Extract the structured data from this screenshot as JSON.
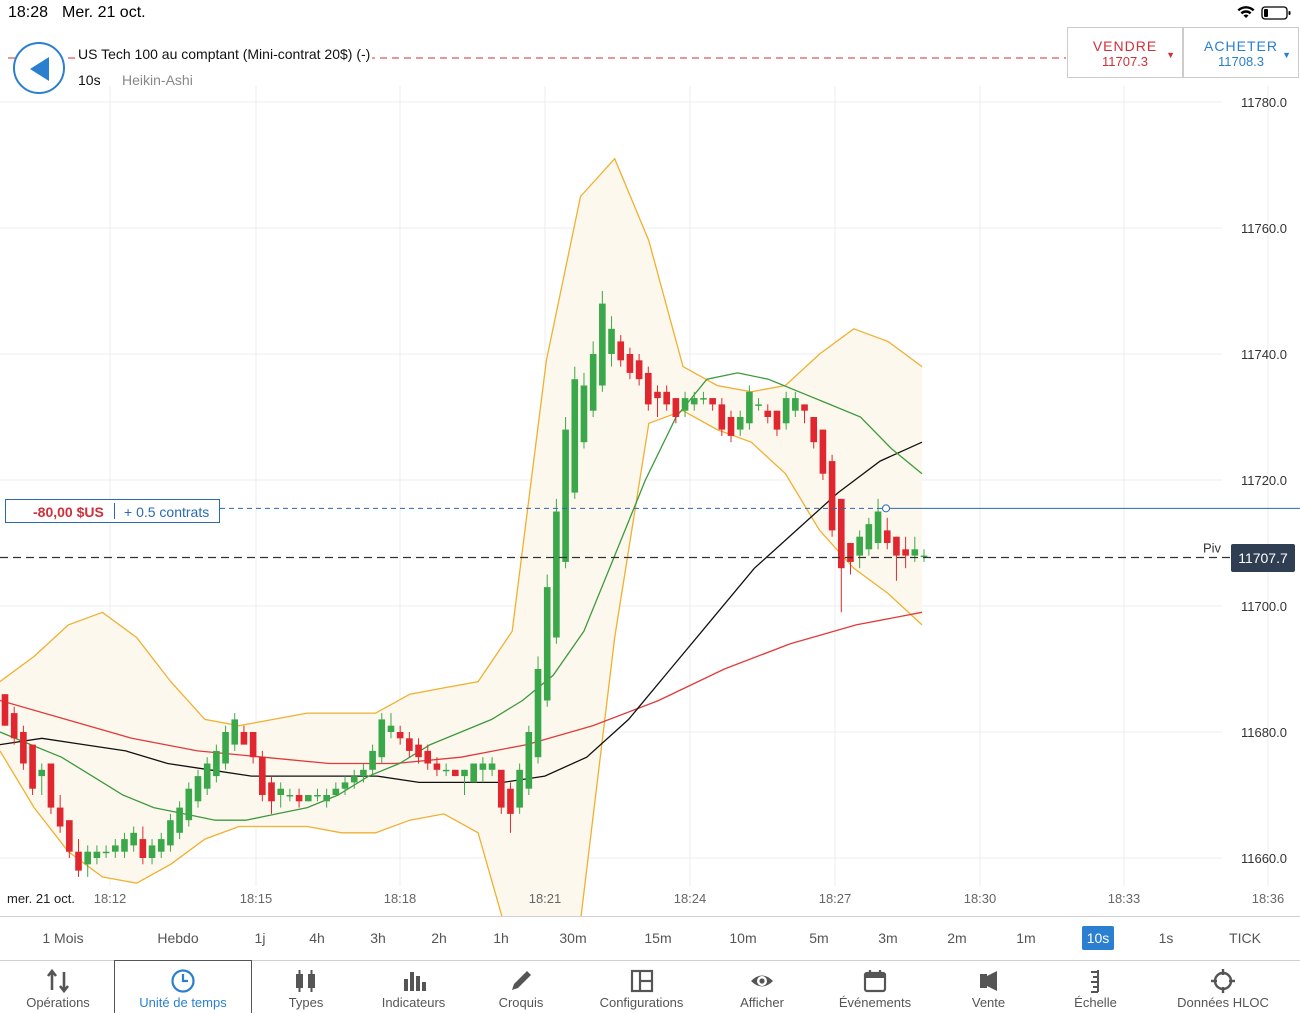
{
  "status_bar": {
    "time": "18:28",
    "date": "Mer. 21 oct."
  },
  "header": {
    "instrument": "US Tech 100 au comptant (Mini-contrat 20$) (-)",
    "timeframe": "10s",
    "chart_type": "Heikin-Ashi"
  },
  "trade": {
    "sell_label": "VENDRE",
    "sell_price": "11707.3",
    "buy_label": "ACHETER",
    "buy_price": "11708.3"
  },
  "position": {
    "pnl": "-80,00 $US",
    "size": "+ 0.5 contrats"
  },
  "pivot_label": "Piv",
  "current_price": "11707.7",
  "date_label": "mer. 21 oct.",
  "colors": {
    "up_candle": "#3aa84a",
    "down_candle": "#e0262f",
    "bollinger": "#f0b030",
    "bollinger_fill": "#fdf8ee",
    "ma_green": "#3c9a3c",
    "ma_black": "#111111",
    "ma_red": "#e03a3a",
    "accent": "#2a7fd1"
  },
  "timeframes": [
    "1 Mois",
    "Hebdo",
    "1j",
    "4h",
    "3h",
    "2h",
    "1h",
    "30m",
    "15m",
    "10m",
    "5m",
    "3m",
    "2m",
    "1m",
    "10s",
    "1s",
    "TICK"
  ],
  "active_timeframe": "10s",
  "toolbar": [
    {
      "label": "Opérations",
      "icon": "arrows-updown-icon"
    },
    {
      "label": "Unité de temps",
      "icon": "clock-icon"
    },
    {
      "label": "Types",
      "icon": "candles-icon"
    },
    {
      "label": "Indicateurs",
      "icon": "bar-chart-icon"
    },
    {
      "label": "Croquis",
      "icon": "pencil-icon"
    },
    {
      "label": "Configurations",
      "icon": "layout-icon"
    },
    {
      "label": "Afficher",
      "icon": "eye-icon"
    },
    {
      "label": "Événements",
      "icon": "calendar-icon"
    },
    {
      "label": "Vente",
      "icon": "speaker-icon"
    },
    {
      "label": "Échelle",
      "icon": "scale-icon"
    },
    {
      "label": "Données HLOC",
      "icon": "crosshair-icon"
    }
  ],
  "active_tool": "Unité de temps",
  "chart_data": {
    "type": "candlestick",
    "price_axis": {
      "ticks": [
        11660,
        11680,
        11700,
        11720,
        11740,
        11760,
        11780
      ],
      "tick_labels": [
        "11660.0",
        "11680.0",
        "11700.0",
        "11720.0",
        "11740.0",
        "11760.0",
        "11780.0"
      ]
    },
    "time_axis": {
      "labels": [
        "18:12",
        "18:15",
        "18:18",
        "18:21",
        "18:24",
        "18:27",
        "18:30",
        "18:33",
        "18:36"
      ]
    },
    "pivot": 11707.7,
    "position_entry": 11715.5,
    "candles": [
      [
        11686,
        11686,
        11681,
        11681
      ],
      [
        11683,
        11684,
        11678,
        11679
      ],
      [
        11680,
        11681,
        11674,
        11675
      ],
      [
        11678,
        11678,
        11670,
        11671
      ],
      [
        11673,
        11675,
        11670,
        11674
      ],
      [
        11675,
        11675,
        11667,
        11668
      ],
      [
        11668,
        11670,
        11664,
        11665
      ],
      [
        11666,
        11666,
        11660,
        11661
      ],
      [
        11661,
        11663,
        11657,
        11658
      ],
      [
        11659,
        11662,
        11657,
        11661
      ],
      [
        11660,
        11662,
        11659,
        11661
      ],
      [
        11661,
        11662,
        11660,
        11661
      ],
      [
        11661,
        11663,
        11660,
        11662
      ],
      [
        11661,
        11664,
        11660,
        11663
      ],
      [
        11662,
        11665,
        11661,
        11664
      ],
      [
        11663,
        11665,
        11659,
        11660
      ],
      [
        11660,
        11663,
        11659,
        11662
      ],
      [
        11661,
        11664,
        11660,
        11663
      ],
      [
        11662,
        11667,
        11661,
        11666
      ],
      [
        11664,
        11669,
        11663,
        11668
      ],
      [
        11666,
        11672,
        11665,
        11671
      ],
      [
        11669,
        11674,
        11668,
        11673
      ],
      [
        11671,
        11676,
        11670,
        11675
      ],
      [
        11673,
        11678,
        11672,
        11677
      ],
      [
        11675,
        11681,
        11674,
        11680
      ],
      [
        11678,
        11683,
        11677,
        11682
      ],
      [
        11680,
        11681,
        11678,
        11678
      ],
      [
        11680,
        11680,
        11675,
        11676
      ],
      [
        11676,
        11677,
        11669,
        11670
      ],
      [
        11672,
        11673,
        11667,
        11669
      ],
      [
        11670,
        11672,
        11668,
        11671
      ],
      [
        11670,
        11671,
        11669,
        11670
      ],
      [
        11670,
        11671,
        11668,
        11669
      ],
      [
        11669,
        11670,
        11669,
        11670
      ],
      [
        11670,
        11671,
        11669,
        11670
      ],
      [
        11669,
        11671,
        11668,
        11670
      ],
      [
        11670,
        11672,
        11670,
        11671
      ],
      [
        11671,
        11673,
        11670,
        11672
      ],
      [
        11672,
        11674,
        11671,
        11673
      ],
      [
        11673,
        11675,
        11672,
        11674
      ],
      [
        11674,
        11678,
        11673,
        11677
      ],
      [
        11676,
        11683,
        11675,
        11682
      ],
      [
        11680,
        11683,
        11679,
        11681
      ],
      [
        11680,
        11681,
        11678,
        11679
      ],
      [
        11679,
        11680,
        11676,
        11677
      ],
      [
        11678,
        11679,
        11675,
        11676
      ],
      [
        11677,
        11678,
        11674,
        11675
      ],
      [
        11675,
        11676,
        11673,
        11674
      ],
      [
        11674,
        11675,
        11673,
        11674
      ],
      [
        11674,
        11674,
        11673,
        11673
      ],
      [
        11673,
        11674,
        11670,
        11674
      ],
      [
        11672,
        11675,
        11672,
        11675
      ],
      [
        11674,
        11676,
        11672,
        11675
      ],
      [
        11674,
        11676,
        11673,
        11675
      ],
      [
        11674,
        11673,
        11667,
        11668
      ],
      [
        11671,
        11672,
        11664,
        11667
      ],
      [
        11668,
        11675,
        11667,
        11674
      ],
      [
        11671,
        11681,
        11670,
        11680
      ],
      [
        11676,
        11692,
        11675,
        11690
      ],
      [
        11685,
        11705,
        11684,
        11703
      ],
      [
        11695,
        11717,
        11694,
        11715
      ],
      [
        11707,
        11730,
        11706,
        11728
      ],
      [
        11718,
        11738,
        11717,
        11736
      ],
      [
        11726,
        11737,
        11725,
        11735
      ],
      [
        11731,
        11742,
        11730,
        11740
      ],
      [
        11735,
        11750,
        11734,
        11748
      ],
      [
        11740,
        11746,
        11738,
        11744
      ],
      [
        11742,
        11743,
        11738,
        11739
      ],
      [
        11740,
        11741,
        11736,
        11737
      ],
      [
        11739,
        11740,
        11735,
        11736
      ],
      [
        11737,
        11738,
        11731,
        11732
      ],
      [
        11734,
        11735,
        11730,
        11733
      ],
      [
        11734,
        11735,
        11731,
        11732
      ],
      [
        11733,
        11733,
        11729,
        11730
      ],
      [
        11731,
        11734,
        11730,
        11733
      ],
      [
        11732,
        11734,
        11731,
        11733
      ],
      [
        11733,
        11734,
        11732,
        11733
      ],
      [
        11733,
        11733,
        11731,
        11732
      ],
      [
        11732,
        11733,
        11727,
        11728
      ],
      [
        11730,
        11731,
        11726,
        11727
      ],
      [
        11728,
        11731,
        11727,
        11730
      ],
      [
        11729,
        11735,
        11728,
        11734
      ],
      [
        11732,
        11733,
        11731,
        11732
      ],
      [
        11731,
        11732,
        11729,
        11730
      ],
      [
        11731,
        11731,
        11727,
        11728
      ],
      [
        11729,
        11734,
        11728,
        11733
      ],
      [
        11731,
        11734,
        11730,
        11733
      ],
      [
        11732,
        11732,
        11729,
        11731
      ],
      [
        11730,
        11730,
        11725,
        11726
      ],
      [
        11728,
        11728,
        11720,
        11721
      ],
      [
        11723,
        11724,
        11711,
        11712
      ],
      [
        11717,
        11717,
        11699,
        11706
      ],
      [
        11710,
        11710,
        11705,
        11707
      ],
      [
        11708,
        11712,
        11706,
        11711
      ],
      [
        11709,
        11714,
        11708,
        11713
      ],
      [
        11710,
        11717,
        11709,
        11715
      ],
      [
        11712,
        11714,
        11709,
        11710
      ],
      [
        11711,
        11711,
        11704,
        11708
      ],
      [
        11709,
        11711,
        11706,
        11708
      ],
      [
        11708,
        11711,
        11707,
        11709
      ],
      [
        11708,
        11709,
        11707,
        11708
      ]
    ],
    "ma_green": [
      11680,
      11678,
      11676,
      11673,
      11670,
      11668,
      11667,
      11666,
      11666,
      11667,
      11668,
      11670,
      11673,
      11675,
      11678,
      11680,
      11682,
      11685,
      11689,
      11696,
      11708,
      11720,
      11730,
      11736,
      11737,
      11736,
      11734,
      11732,
      11730,
      11725,
      11721
    ],
    "ma_black": [
      11678,
      11679,
      11678,
      11677,
      11675,
      11674,
      11673,
      11673,
      11673,
      11673,
      11672,
      11672,
      11672,
      11673,
      11676,
      11682,
      11690,
      11698,
      11706,
      11712,
      11718,
      11723,
      11726
    ],
    "ma_red": [
      11685,
      11682,
      11679,
      11677,
      11676,
      11675,
      11675,
      11676,
      11678,
      11681,
      11685,
      11690,
      11694,
      11697,
      11699
    ],
    "bollinger_upper": [
      11688,
      11692,
      11697,
      11699,
      11695,
      11688,
      11682,
      11681,
      11682,
      11683,
      11683,
      11683,
      11686,
      11687,
      11688,
      11696,
      11739,
      11765,
      11771,
      11758,
      11738,
      11735,
      11734,
      11735,
      11740,
      11744,
      11742,
      11738
    ],
    "bollinger_lower": [
      11677,
      11668,
      11661,
      11657,
      11656,
      11659,
      11663,
      11665,
      11665,
      11665,
      11664,
      11664,
      11666,
      11667,
      11664,
      11645,
      11640,
      11650,
      11695,
      11729,
      11731,
      11728,
      11726,
      11721,
      11712,
      11706,
      11702,
      11697
    ]
  }
}
